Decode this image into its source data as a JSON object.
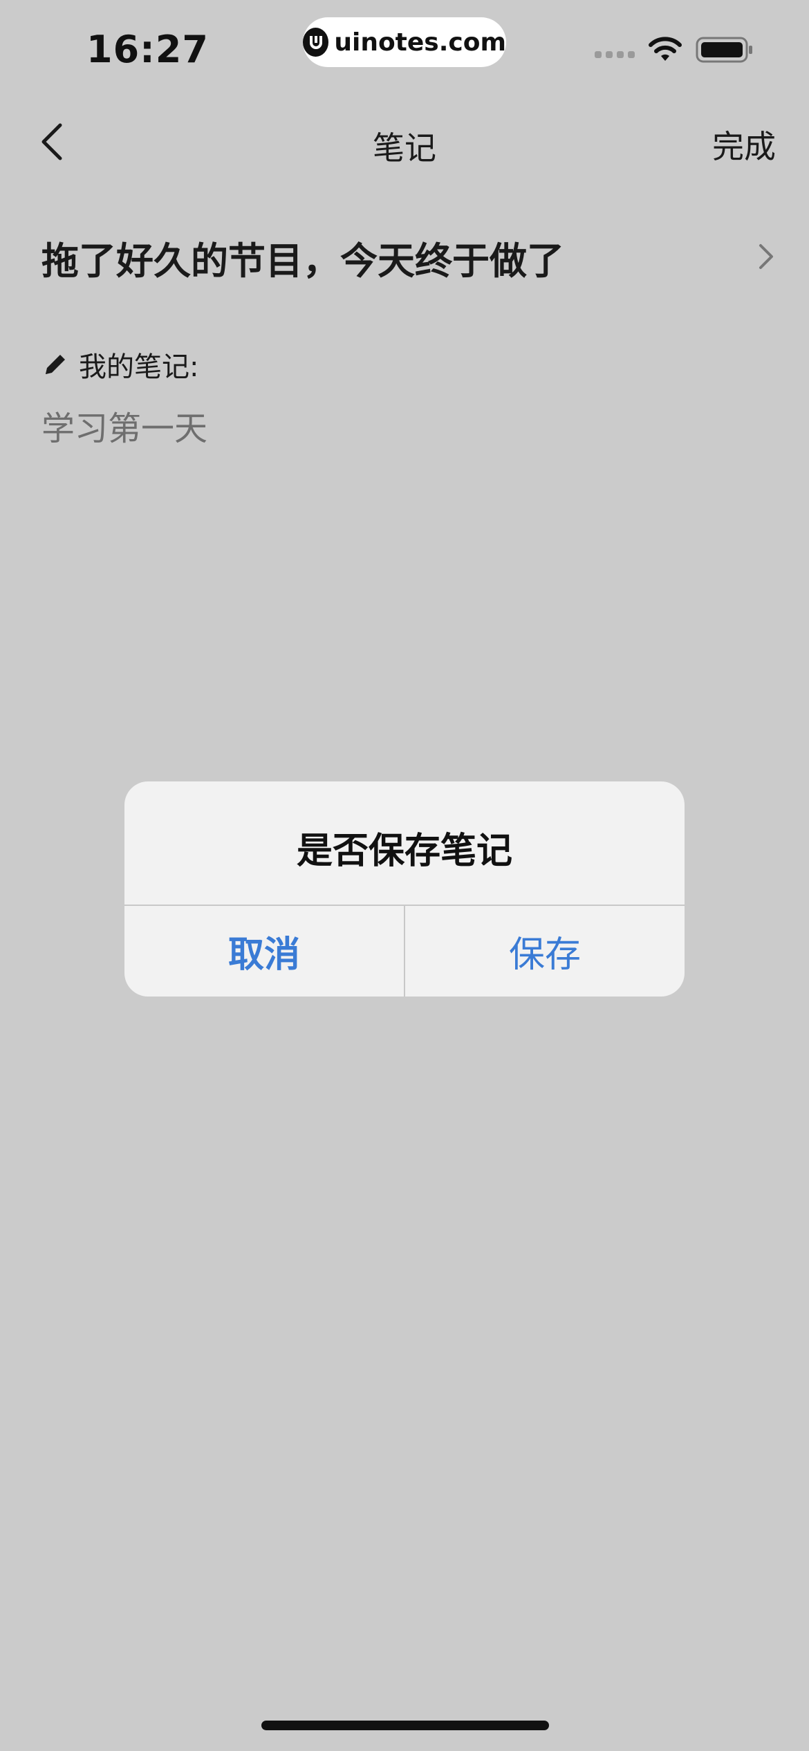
{
  "status_bar": {
    "time": "16:27",
    "watermark": "uinotes.com",
    "icons": [
      "cellular-signal-icon",
      "wifi-icon",
      "battery-icon"
    ]
  },
  "nav": {
    "title": "笔记",
    "done_label": "完成",
    "back_icon": "chevron-left-icon"
  },
  "content": {
    "note_title": "拖了好久的节目，今天终于做了",
    "my_note_label": "我的笔记:",
    "note_body": "学习第一天",
    "edit_icon": "pencil-icon",
    "chevron_icon": "chevron-right-icon"
  },
  "alert": {
    "title": "是否保存笔记",
    "cancel_label": "取消",
    "save_label": "保存",
    "button_color": "#3a7bd5"
  },
  "colors": {
    "background": "#cbcbcb",
    "dialog": "#f2f2f2",
    "accent": "#3a7bd5"
  }
}
